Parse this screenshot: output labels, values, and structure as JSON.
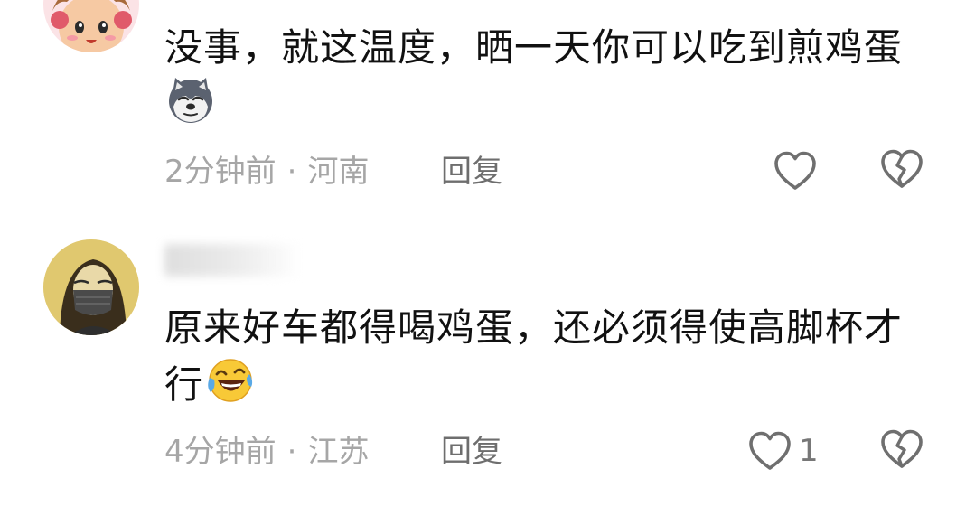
{
  "comments": [
    {
      "text": "没事，就这温度，晒一天你可以吃到煎鸡蛋",
      "emoji": "husky-dog-emoji",
      "time": "2分钟前",
      "separator": "·",
      "location": "河南",
      "reply_label": "回复",
      "like_count": "",
      "avatar": "cartoon-girl-avatar"
    },
    {
      "text": "原来好车都得喝鸡蛋，还必须得使高脚杯才行",
      "emoji": "laughing-crying-emoji",
      "time": "4分钟前",
      "separator": "·",
      "location": "江苏",
      "reply_label": "回复",
      "like_count": "1",
      "avatar": "masked-woman-avatar"
    }
  ],
  "icons": {
    "like": "heart-outline-icon",
    "dislike": "broken-heart-icon"
  },
  "colors": {
    "text": "#111111",
    "meta": "#a6a6a6",
    "reply": "#6e6e6e",
    "icon": "#6f6f6f"
  }
}
